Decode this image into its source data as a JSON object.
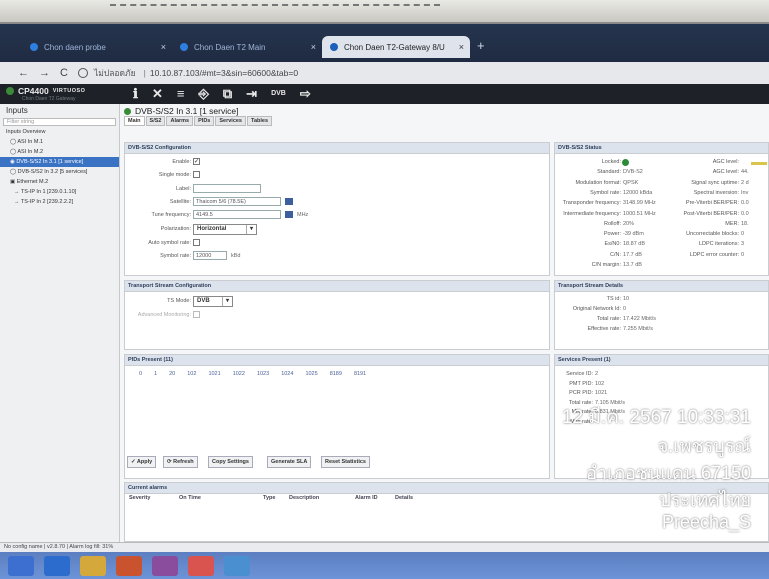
{
  "browser": {
    "tabs": [
      {
        "label": "Chon daen probe"
      },
      {
        "label": "Chon Daen T2 Main"
      },
      {
        "label": "Chon Daen T2-Gateway 8/U"
      }
    ],
    "new_tab_label": "+",
    "nav": {
      "back": "←",
      "forward": "→",
      "reload": "C"
    },
    "url_insecure_label": "ไม่ปลอดภัย",
    "url_sep": "|",
    "url": "10.10.87.103/#mt=3&sin=60600&tab=0"
  },
  "app": {
    "brand": "CP4400",
    "brand_sub": "VIRTUOSO",
    "brand_sub2": "Chon Daen T2 Gateway",
    "toolbar_icons": [
      {
        "name": "info-icon",
        "glyph": "ℹ"
      },
      {
        "name": "tools-icon",
        "glyph": "✕"
      },
      {
        "name": "server-icon",
        "glyph": "≡"
      },
      {
        "name": "login-icon",
        "glyph": "⎆"
      },
      {
        "name": "network-icon",
        "glyph": "⧉"
      },
      {
        "name": "output-icon",
        "glyph": "⇥"
      },
      {
        "name": "dvb-icon",
        "glyph": "DVB"
      },
      {
        "name": "logout-icon",
        "glyph": "⇨"
      }
    ]
  },
  "sidebar": {
    "title": "Inputs",
    "filter": "Filter string",
    "items": [
      {
        "label": "Inputs Overview",
        "indent": 0,
        "selected": false
      },
      {
        "label": "◯ ASI In M.1",
        "indent": 1,
        "selected": false
      },
      {
        "label": "◯ ASI In M.2",
        "indent": 1,
        "selected": false
      },
      {
        "label": "◉ DVB-S/S2 In 3.1 [1 service]",
        "indent": 1,
        "selected": true
      },
      {
        "label": "◯ DVB-S/S2 In 3.2 [5 services]",
        "indent": 1,
        "selected": false
      },
      {
        "label": "▣ Ethernet M.2",
        "indent": 1,
        "selected": false
      },
      {
        "label": "→ TS-IP In 1 [239.0.1.10]",
        "indent": 2,
        "selected": false
      },
      {
        "label": "→ TS-IP In 2 [239.2.2.2]",
        "indent": 2,
        "selected": false
      }
    ]
  },
  "main": {
    "title": "DVB-S/S2 In 3.1 [1 service]",
    "tabs": [
      "Main",
      "S/S2",
      "Alarms",
      "PIDs",
      "Services",
      "Tables"
    ],
    "config": {
      "header": "DVB-S/S2 Configuration",
      "enable_label": "Enable:",
      "single_mode_label": "Single mode:",
      "label_label": "Label:",
      "satellite_label": "Satellite:",
      "satellite_value": "Thaicom 5/6 (78.5E)",
      "tune_freq_label": "Tune frequency:",
      "tune_freq_value": "4149.5",
      "tune_freq_unit": "MHz",
      "polarization_label": "Polarization:",
      "polarization_value": "Horizontal",
      "auto_symbol_label": "Auto symbol rate:",
      "symbol_rate_label": "Symbol rate:",
      "symbol_rate_value": "12000",
      "symbol_rate_unit": "kBd"
    },
    "status": {
      "header": "DVB-S/S2 Status",
      "left": [
        {
          "label": "Locked:",
          "value": ""
        },
        {
          "label": "Standard:",
          "value": "DVB-S2"
        },
        {
          "label": "Modulation format:",
          "value": "QPSK"
        },
        {
          "label": "Symbol rate:",
          "value": "12000 kBda"
        },
        {
          "label": "Transponder frequency:",
          "value": "3148.99 MHz"
        },
        {
          "label": "Intermediate frequency:",
          "value": "1000.51 MHz"
        },
        {
          "label": "Rolloff:",
          "value": "20%"
        },
        {
          "label": "Power:",
          "value": "-39 dBm"
        },
        {
          "label": "Es/N0:",
          "value": "18.87 dB"
        },
        {
          "label": "C/N:",
          "value": "17.7 dB"
        },
        {
          "label": "C/N margin:",
          "value": "13.7 dB"
        }
      ],
      "right": [
        {
          "label": "AGC level:",
          "value": ""
        },
        {
          "label": "AGC level:",
          "value": "44."
        },
        {
          "label": "Signal sync uptime:",
          "value": "2 d"
        },
        {
          "label": "Spectral inversion:",
          "value": "Inv"
        },
        {
          "label": "Pre-Viterbi BER/PER:",
          "value": "0.0"
        },
        {
          "label": "Post-Viterbi BER/PER:",
          "value": "0.0"
        },
        {
          "label": "MER:",
          "value": "18."
        },
        {
          "label": "Uncorrectable blocks:",
          "value": "0"
        },
        {
          "label": "LDPC iterations:",
          "value": "3"
        },
        {
          "label": "LDPC error counter:",
          "value": "0"
        }
      ]
    },
    "ts_config": {
      "header": "Transport Stream Configuration",
      "ts_mode_label": "TS Mode:",
      "ts_mode_value": "DVB",
      "adv_monitoring_label": "Advanced Monitoring:"
    },
    "ts_details": {
      "header": "Transport Stream Details",
      "rows": [
        {
          "label": "TS id:",
          "value": "10"
        },
        {
          "label": "Original Network Id:",
          "value": "0"
        },
        {
          "label": "Total rate:",
          "value": "17.422 Mbit/s"
        },
        {
          "label": "Effective rate:",
          "value": "7.255 Mbit/s"
        }
      ]
    },
    "pids": {
      "header": "PIDs Present (11)",
      "values": [
        "0",
        "1",
        "20",
        "102",
        "1021",
        "1022",
        "1023",
        "1024",
        "1025",
        "8189",
        "8191"
      ]
    },
    "services": {
      "header": "Services Present (1)",
      "rows": [
        {
          "label": "Service ID:",
          "value": "2"
        },
        {
          "label": "PMT PID:",
          "value": "102"
        },
        {
          "label": "PCR PID:",
          "value": "1021"
        },
        {
          "label": "Total rate:",
          "value": "7.105 Mbit/s"
        },
        {
          "label": "Min rate:",
          "value": "0.831 Mbit/s"
        },
        {
          "label": "Max rate:",
          "value": ""
        }
      ]
    },
    "buttons": {
      "apply": "✓ Apply",
      "refresh": "⟳ Refresh",
      "copy_settings": "Copy Settings",
      "generate_sla": "Generate SLA",
      "reset_statistics": "Reset Statistics"
    },
    "alarms": {
      "header": "Current alarms",
      "columns": [
        "Severity",
        "On Time",
        "Type",
        "Description",
        "Alarm ID",
        "Details"
      ]
    }
  },
  "statusbar": {
    "text": "No config name  |  v2.8.70  |  Alarm log fill: 31%"
  },
  "overlay": {
    "datetime": "12 มี.ค. 2567 10:33:31",
    "province": "จ.เพชรบูรณ์",
    "district": "อำเภอชนแดน 67150",
    "country": "ประเทศไทย",
    "user": "Preecha_S"
  },
  "colors": {
    "accent": "#3b73c4",
    "locked_green": "#2f8a38",
    "taskbar": "#5b7fc0"
  }
}
